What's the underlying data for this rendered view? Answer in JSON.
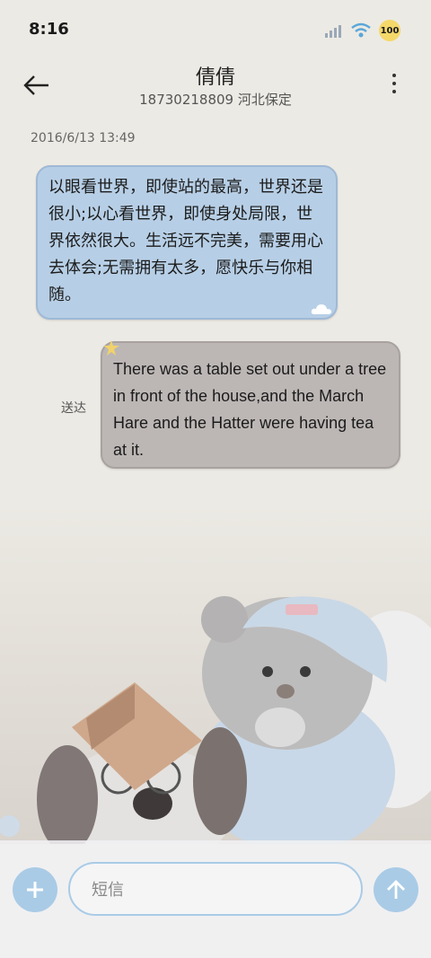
{
  "status_bar": {
    "time": "8:16",
    "battery_level": "100"
  },
  "header": {
    "contact_name": "倩倩",
    "phone_location": "18730218809 河北保定"
  },
  "conversation": {
    "timestamp": "2016/6/13 13:49",
    "received_message": "以眼看世界，即使站的最高，世界还是很小;以心看世界，即使身处局限，世界依然很大。生活远不完美，需要用心去体会;无需拥有太多，愿快乐与你相随。",
    "sent_message": "There was a table set out under a tree in front of the house,and the March Hare and the Hatter were having tea at it.",
    "sent_status": "送达"
  },
  "composer": {
    "placeholder": "短信"
  },
  "colors": {
    "accent": "#a9cbe6",
    "received_bubble": "#b7cfe6",
    "sent_bubble": "#bcb7b5"
  },
  "icons": [
    "back-arrow-icon",
    "more-vert-icon",
    "signal-icon",
    "wifi-icon",
    "plus-icon",
    "send-arrow-icon",
    "cloud-icon",
    "star-icon"
  ]
}
